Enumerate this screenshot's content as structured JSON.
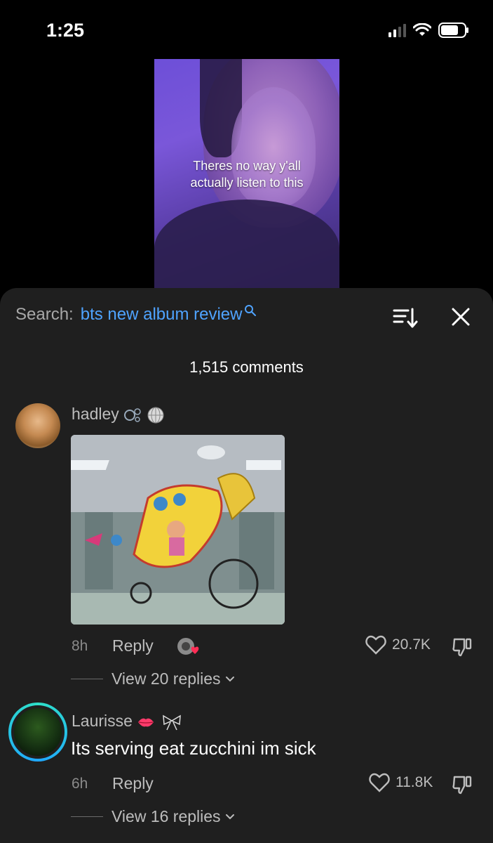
{
  "status": {
    "time": "1:25"
  },
  "video": {
    "caption_line1": "Theres no way y'all",
    "caption_line2": "actually listen to this"
  },
  "search": {
    "label": "Search:",
    "query": "bts new album review"
  },
  "comments_header": {
    "count_label": "1,515 comments"
  },
  "comments": [
    {
      "username": "hadley",
      "time": "8h",
      "reply_label": "Reply",
      "likes": "20.7K",
      "view_replies": "View 20 replies"
    },
    {
      "username": "Laurisse",
      "text": "Its serving eat zucchini im sick",
      "time": "6h",
      "reply_label": "Reply",
      "likes": "11.8K",
      "view_replies": "View 16 replies"
    }
  ],
  "colors": {
    "accent": "#4fa3ff",
    "sheet": "#1f1f1f",
    "muted": "#bdbdbd"
  },
  "icons": [
    "signal-icon",
    "wifi-icon",
    "battery-icon",
    "search-icon",
    "sort-icon",
    "close-icon",
    "heart-icon",
    "dislike-icon",
    "chevron-down-icon"
  ]
}
